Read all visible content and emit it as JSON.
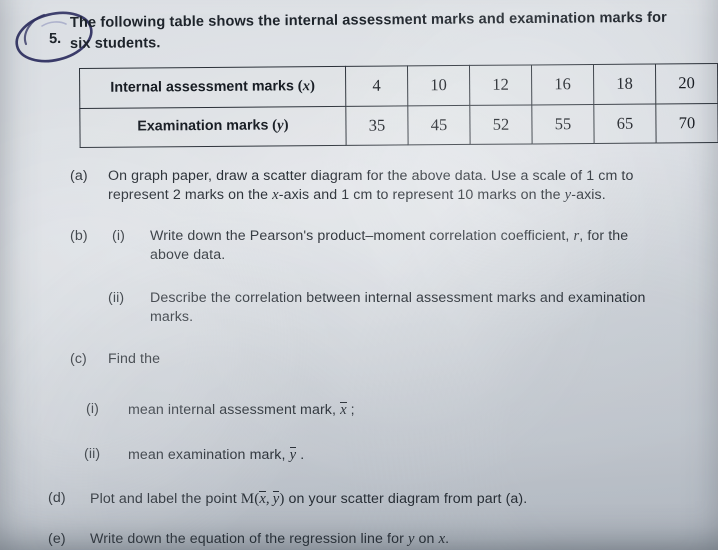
{
  "question": {
    "number": "5.",
    "intro_line1": "The following table shows the internal assessment marks and examination marks for",
    "intro_line2": "six students."
  },
  "table": {
    "rows": [
      {
        "label_text": "Internal assessment marks",
        "label_var": "x",
        "values": [
          "4",
          "10",
          "12",
          "16",
          "18",
          "20"
        ]
      },
      {
        "label_text": "Examination marks",
        "label_var": "y",
        "values": [
          "35",
          "45",
          "52",
          "55",
          "65",
          "70"
        ]
      }
    ]
  },
  "parts": {
    "a": {
      "marker": "(a)",
      "line1_a": "On graph paper",
      "line1_b": ", draw a scatter diagram for the above data.  Use a scale of 1 cm to",
      "line2_a": "represent 2 marks on the ",
      "line2_x": "x",
      "line2_b": "-axis and 1 cm to represent 10 marks on the ",
      "line2_y": "y",
      "line2_c": "-axis."
    },
    "b": {
      "marker": "(b)",
      "i": {
        "marker": "(i)",
        "line1_a": "Write down the Pearson's product–moment correlation coefficient, ",
        "line1_r": "r",
        "line1_b": ", for the",
        "line2": "above data."
      },
      "ii": {
        "marker": "(ii)",
        "line1": "Describe the correlation between internal assessment marks and examination",
        "line2": "marks."
      }
    },
    "c": {
      "marker": "(c)",
      "text": "Find the",
      "i": {
        "marker": "(i)",
        "text_a": "mean internal assessment mark, ",
        "var": "x",
        "text_b": " ;"
      },
      "ii": {
        "marker": "(ii)",
        "text_a": "mean examination mark, ",
        "var": "y",
        "text_b": " ."
      }
    },
    "d": {
      "marker": "(d)",
      "text_a": "Plot and label the point ",
      "m": "M",
      "paren_open": "(",
      "var_x": "x",
      "comma": ",",
      "var_y": "y",
      "paren_close": ")",
      "text_b": " on your scatter diagram from part (a)."
    },
    "e": {
      "marker": "(e)",
      "text_a": "Write down the equation of the regression line for ",
      "var_y": "y",
      "text_mid": " on ",
      "var_x": "x",
      "text_b": "."
    }
  },
  "ink": {
    "circle_color": "#2b2c5e"
  }
}
